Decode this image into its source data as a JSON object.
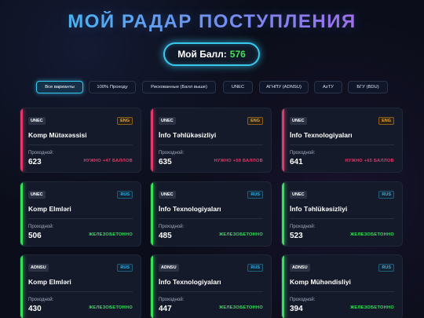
{
  "header": {
    "title": "МОЙ РАДАР ПОСТУПЛЕНИЯ"
  },
  "score": {
    "label": "Мой Балл:",
    "value": "576"
  },
  "filters": [
    {
      "label": "Все варианты",
      "active": true
    },
    {
      "label": "100% Проходу",
      "active": false
    },
    {
      "label": "Рискованные (Балл выше)",
      "active": false
    },
    {
      "label": "UNEC",
      "active": false
    },
    {
      "label": "АГНПУ (ADNSU)",
      "active": false
    },
    {
      "label": "AzTУ",
      "active": false
    },
    {
      "label": "БГУ (BDU)",
      "active": false
    }
  ],
  "cards": [
    {
      "uni": "UNEC",
      "lang": "ENG",
      "major": "Komp Mütəxəssisi",
      "pass_label": "Проходной:",
      "pass": "623",
      "status": "НУЖНО +47 БАЛЛОВ",
      "kind": "need"
    },
    {
      "uni": "UNEC",
      "lang": "ENG",
      "major": "İnfo Təhlükəsizliyi",
      "pass_label": "Проходной:",
      "pass": "635",
      "status": "НУЖНО +59 БАЛЛОВ",
      "kind": "need"
    },
    {
      "uni": "UNEC",
      "lang": "ENG",
      "major": "İnfo Texnologiyaları",
      "pass_label": "Проходной:",
      "pass": "641",
      "status": "НУЖНО +65 БАЛЛОВ",
      "kind": "need"
    },
    {
      "uni": "UNEC",
      "lang": "RUS",
      "major": "Komp Elmləri",
      "pass_label": "Проходной:",
      "pass": "506",
      "status": "ЖЕЛЕЗОБЕТОННО",
      "kind": "ok"
    },
    {
      "uni": "UNEC",
      "lang": "RUS",
      "major": "İnfo Texnologiyaları",
      "pass_label": "Проходной:",
      "pass": "485",
      "status": "ЖЕЛЕЗОБЕТОННО",
      "kind": "ok"
    },
    {
      "uni": "UNEC",
      "lang": "RUS",
      "major": "İnfo Təhlükəsizliyi",
      "pass_label": "Проходной:",
      "pass": "523",
      "status": "ЖЕЛЕЗОБЕТОННО",
      "kind": "ok"
    },
    {
      "uni": "ADNSU",
      "lang": "RUS",
      "major": "Komp Elmləri",
      "pass_label": "Проходной:",
      "pass": "430",
      "status": "ЖЕЛЕЗОБЕТОННО",
      "kind": "ok"
    },
    {
      "uni": "ADNSU",
      "lang": "RUS",
      "major": "İnfo Texnologiyaları",
      "pass_label": "Проходной:",
      "pass": "447",
      "status": "ЖЕЛЕЗОБЕТОННО",
      "kind": "ok"
    },
    {
      "uni": "ADNSU",
      "lang": "RUS",
      "major": "Komp Mühəndisliyi",
      "pass_label": "Проходной:",
      "pass": "394",
      "status": "ЖЕЛЕЗОБЕТОННО",
      "kind": "ok"
    }
  ]
}
